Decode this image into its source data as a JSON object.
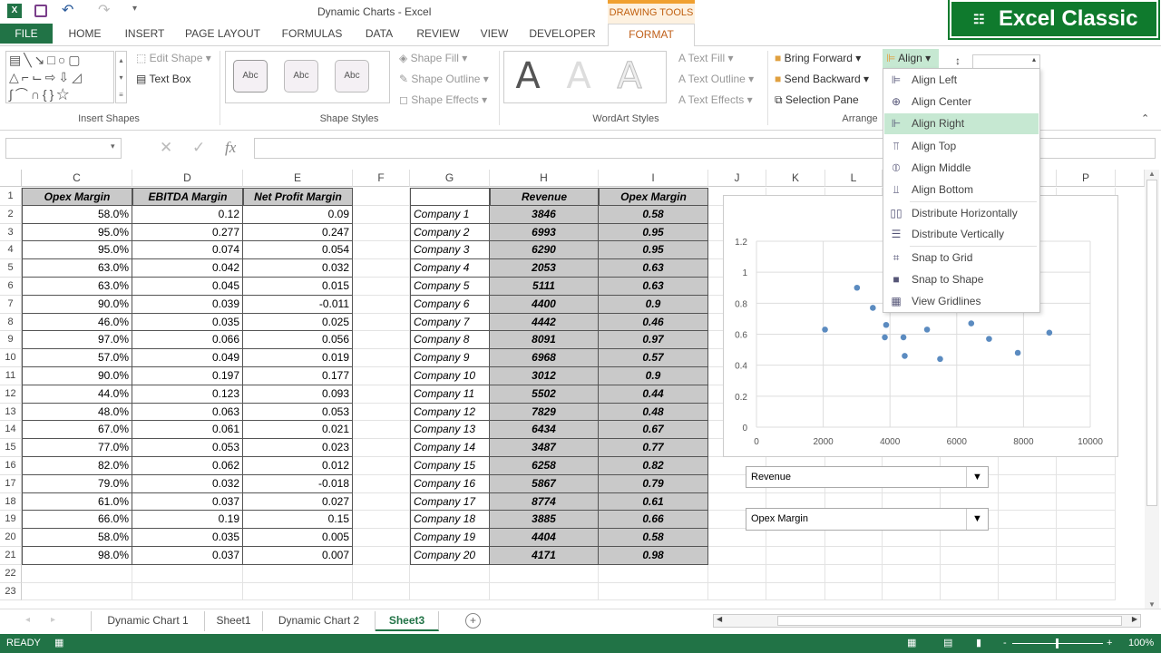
{
  "app": {
    "title": "Dynamic Charts - Excel",
    "context_tab_group": "DRAWING TOOLS",
    "banner": "Excel Classic",
    "accent": "#217346",
    "context_color": "#f0a030"
  },
  "qat": {
    "icons": [
      "excel-icon",
      "save-icon",
      "undo-icon",
      "redo-icon",
      "customize-icon"
    ]
  },
  "tabs": [
    "FILE",
    "HOME",
    "INSERT",
    "PAGE LAYOUT",
    "FORMULAS",
    "DATA",
    "REVIEW",
    "VIEW",
    "DEVELOPER",
    "FORMAT"
  ],
  "ribbon": {
    "insert_shapes": {
      "label": "Insert Shapes",
      "edit_shape": "Edit Shape",
      "text_box": "Text Box"
    },
    "shape_styles": {
      "label": "Shape Styles",
      "samples": [
        "Abc",
        "Abc",
        "Abc"
      ],
      "shape_fill": "Shape Fill",
      "shape_outline": "Shape Outline",
      "shape_effects": "Shape Effects"
    },
    "wordart": {
      "label": "WordArt Styles",
      "samples": [
        "A",
        "A",
        "A"
      ],
      "text_fill": "Text Fill",
      "text_outline": "Text Outline",
      "text_effects": "Text Effects"
    },
    "arrange": {
      "label": "Arrange",
      "bring_forward": "Bring Forward",
      "send_backward": "Send Backward",
      "selection_pane": "Selection Pane",
      "align": "Align"
    }
  },
  "align_menu": [
    {
      "label": "Align Left",
      "icon": "align-left-icon",
      "glyph": "⊫"
    },
    {
      "label": "Align Center",
      "icon": "align-center-icon",
      "glyph": "⊕"
    },
    {
      "label": "Align Right",
      "icon": "align-right-icon",
      "glyph": "⊩",
      "highlighted": true
    },
    {
      "label": "Align Top",
      "icon": "align-top-icon",
      "glyph": "⫪"
    },
    {
      "label": "Align Middle",
      "icon": "align-middle-icon",
      "glyph": "⦶"
    },
    {
      "label": "Align Bottom",
      "icon": "align-bottom-icon",
      "glyph": "⫫"
    },
    {
      "label": "Distribute Horizontally",
      "icon": "distribute-horizontally-icon",
      "glyph": "▯▯"
    },
    {
      "label": "Distribute Vertically",
      "icon": "distribute-vertically-icon",
      "glyph": "☰"
    },
    {
      "label": "Snap to Grid",
      "icon": "snap-to-grid-icon",
      "glyph": "⌗"
    },
    {
      "label": "Snap to Shape",
      "icon": "snap-to-shape-icon",
      "glyph": "■"
    },
    {
      "label": "View Gridlines",
      "icon": "view-gridlines-icon",
      "glyph": "▦"
    }
  ],
  "formula_bar": {
    "name_box": "",
    "formula": "",
    "fx": "fx"
  },
  "columns": [
    "C",
    "D",
    "E",
    "F",
    "G",
    "H",
    "I",
    "J",
    "K",
    "L",
    "M",
    "N",
    "O",
    "P"
  ],
  "rows_numbers": [
    "1",
    "2",
    "3",
    "4",
    "5",
    "6",
    "7",
    "8",
    "9",
    "10",
    "11",
    "12",
    "13",
    "14",
    "15",
    "16",
    "17",
    "18",
    "19",
    "20",
    "21",
    "22",
    "23"
  ],
  "table_left": {
    "headers": [
      "Opex Margin",
      "EBITDA Margin",
      "Net Profit Margin"
    ],
    "opex_margin": [
      "58.0%",
      "95.0%",
      "95.0%",
      "63.0%",
      "63.0%",
      "90.0%",
      "46.0%",
      "97.0%",
      "57.0%",
      "90.0%",
      "44.0%",
      "48.0%",
      "67.0%",
      "77.0%",
      "82.0%",
      "79.0%",
      "61.0%",
      "66.0%",
      "58.0%",
      "98.0%"
    ],
    "ebitda_margin": [
      "0.12",
      "0.277",
      "0.074",
      "0.042",
      "0.045",
      "0.039",
      "0.035",
      "0.066",
      "0.049",
      "0.197",
      "0.123",
      "0.063",
      "0.061",
      "0.053",
      "0.062",
      "0.032",
      "0.037",
      "0.19",
      "0.035",
      "0.037"
    ],
    "net_profit_margin": [
      "0.09",
      "0.247",
      "0.054",
      "0.032",
      "0.015",
      "-0.011",
      "0.025",
      "0.056",
      "0.019",
      "0.177",
      "0.093",
      "0.053",
      "0.021",
      "0.023",
      "0.012",
      "-0.018",
      "0.027",
      "0.15",
      "0.005",
      "0.007"
    ]
  },
  "table_right": {
    "headers": [
      "",
      "Revenue",
      "Opex Margin"
    ],
    "companies": [
      "Company 1",
      "Company 2",
      "Company 3",
      "Company 4",
      "Company 5",
      "Company 6",
      "Company 7",
      "Company 8",
      "Company 9",
      "Company 10",
      "Company 11",
      "Company 12",
      "Company 13",
      "Company 14",
      "Company 15",
      "Company 16",
      "Company 17",
      "Company 18",
      "Company 19",
      "Company 20"
    ],
    "revenue": [
      "3846",
      "6993",
      "6290",
      "2053",
      "5111",
      "4400",
      "4442",
      "8091",
      "6968",
      "3012",
      "5502",
      "7829",
      "6434",
      "3487",
      "6258",
      "5867",
      "8774",
      "3885",
      "4404",
      "4171"
    ],
    "opex_margin": [
      "0.58",
      "0.95",
      "0.95",
      "0.63",
      "0.63",
      "0.9",
      "0.46",
      "0.97",
      "0.57",
      "0.9",
      "0.44",
      "0.48",
      "0.67",
      "0.77",
      "0.82",
      "0.79",
      "0.61",
      "0.66",
      "0.58",
      "0.98"
    ]
  },
  "chart_data": {
    "type": "scatter",
    "x": [
      3846,
      6993,
      6290,
      2053,
      5111,
      4400,
      4442,
      8091,
      6968,
      3012,
      5502,
      7829,
      6434,
      3487,
      6258,
      5867,
      8774,
      3885,
      4404,
      4171
    ],
    "y": [
      0.58,
      0.95,
      0.95,
      0.63,
      0.63,
      0.9,
      0.46,
      0.97,
      0.57,
      0.9,
      0.44,
      0.48,
      0.67,
      0.77,
      0.82,
      0.79,
      0.61,
      0.66,
      0.58,
      0.98
    ],
    "xlim": [
      0,
      10000
    ],
    "ylim": [
      0,
      1.2
    ],
    "xticks": [
      "0",
      "2000",
      "4000",
      "6000",
      "8000",
      "10000"
    ],
    "yticks": [
      "0",
      "0.2",
      "0.4",
      "0.6",
      "0.8",
      "1",
      "1.2"
    ],
    "grid": true,
    "color": "#5b8bc0"
  },
  "combos": {
    "x_select": "Revenue",
    "y_select": "Opex Margin"
  },
  "sheets": [
    "Dynamic Chart 1",
    "Sheet1",
    "Dynamic Chart 2",
    "Sheet3"
  ],
  "active_sheet": "Sheet3",
  "status": {
    "ready": "READY",
    "zoom": "100%",
    "zoom_level": 100
  }
}
